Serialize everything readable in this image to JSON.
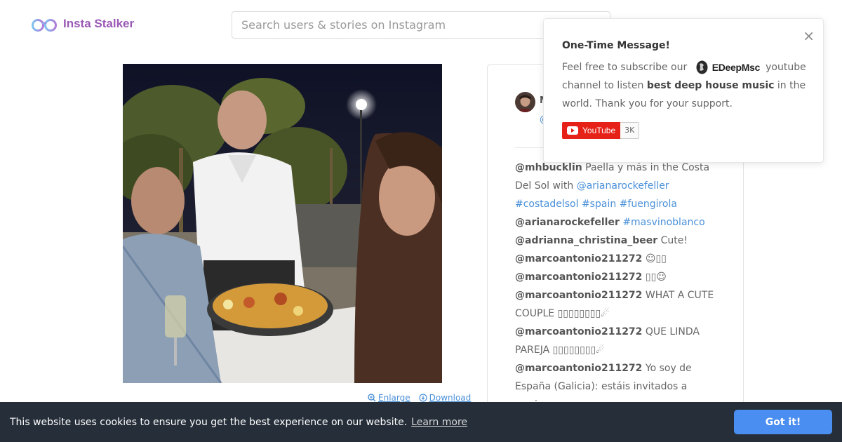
{
  "app": {
    "logo_text": "Insta Stalker",
    "brand_color": "#9b59b6"
  },
  "search": {
    "placeholder": "Search users & stories on Instagram"
  },
  "image_actions": {
    "enlarge": "Enlarge",
    "download": "Download"
  },
  "profile": {
    "name": "M",
    "handle": "@"
  },
  "comments": [
    {
      "user": "@mhbucklin",
      "segments": [
        {
          "t": " Paella y más in the Costa Del Sol with ",
          "link": false
        },
        {
          "t": "@arianarockefeller",
          "link": true
        },
        {
          "t": " ",
          "link": false
        },
        {
          "t": "#costadelsol",
          "link": true
        },
        {
          "t": " ",
          "link": false
        },
        {
          "t": "#spain",
          "link": true
        },
        {
          "t": " ",
          "link": false
        },
        {
          "t": "#fuengirola",
          "link": true
        }
      ]
    },
    {
      "user": "@arianarockefeller",
      "segments": [
        {
          "t": " ",
          "link": false
        },
        {
          "t": "#masvinoblanco",
          "link": true
        }
      ]
    },
    {
      "user": "@adrianna_christina_beer",
      "segments": [
        {
          "t": " Cute!",
          "link": false
        }
      ]
    },
    {
      "user": "@marcoantonio211272",
      "segments": [
        {
          "t": " ☺▯▯",
          "link": false
        }
      ]
    },
    {
      "user": "@marcoantonio211272",
      "segments": [
        {
          "t": " ▯▯☺",
          "link": false
        }
      ]
    },
    {
      "user": "@marcoantonio211272",
      "segments": [
        {
          "t": " WHAT A CUTE COUPLE ▯▯▯▯▯▯▯▯☄",
          "link": false
        }
      ]
    },
    {
      "user": "@marcoantonio211272",
      "segments": [
        {
          "t": " QUE LINDA PAREJA ▯▯▯▯▯▯▯▯☄",
          "link": false
        }
      ]
    },
    {
      "user": "@marcoantonio211272",
      "segments": [
        {
          "t": " Yo soy de España (Galicia): estáis invitados a marisco, ",
          "link": false
        }
      ]
    }
  ],
  "popup": {
    "title": "One-Time Message!",
    "close_icon": "×",
    "body_before": "Feel free to subscribe our",
    "brand_name": "EDeepMsc",
    "body_after_1": "youtube channel to listen",
    "body_bold": "best deep house music",
    "body_after_2": "in the world. Thank you for your support.",
    "youtube_label": "YouTube",
    "youtube_count": "3K"
  },
  "cookie": {
    "message": "This website uses cookies to ensure you get the best experience on our website.",
    "learn_more": "Learn more",
    "accept": "Got it!"
  }
}
